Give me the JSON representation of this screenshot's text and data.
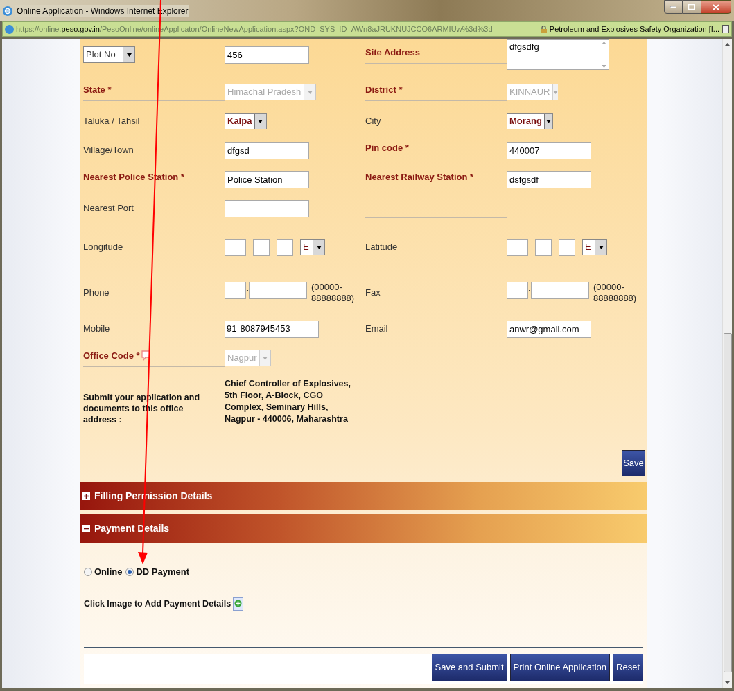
{
  "window": {
    "title": "Online Application - Windows Internet Explorer",
    "url_scheme": "https://online.",
    "url_domain": "peso.gov.in",
    "url_path": "/PesoOnline/onlineApplicaton/OnlineNewApplication.aspx?OND_SYS_ID=AWn8aJRUKNUJCCO6ARMIUw%3d%3d",
    "site_identity": "Petroleum and Explosives Safety Organization [I..."
  },
  "form_rows": [
    {
      "kind": "top",
      "cells": [
        {
          "label": {
            "kind": "select",
            "text": "Plot No"
          },
          "control": {
            "kind": "text",
            "value": "456"
          }
        },
        {
          "label": {
            "kind": "required",
            "text": "Site Address"
          },
          "control": {
            "kind": "textarea",
            "value": "dfgsdfg"
          }
        }
      ]
    },
    {
      "kind": "plain",
      "cells": [
        {
          "label": {
            "kind": "required",
            "text": "State *"
          },
          "control": {
            "kind": "select",
            "value": "Himachal Pradesh",
            "disabled": true
          }
        },
        {
          "label": {
            "kind": "required",
            "text": "District *"
          },
          "control": {
            "kind": "select",
            "value": "KINNAUR",
            "disabled": true
          }
        }
      ]
    },
    {
      "kind": "plain",
      "cells": [
        {
          "label": {
            "kind": "plain",
            "text": "Taluka / Tahsil"
          },
          "control": {
            "kind": "select",
            "value": "Kalpa",
            "disabled": false
          }
        },
        {
          "label": {
            "kind": "plain",
            "text": "City"
          },
          "control": {
            "kind": "select",
            "value": "Morang",
            "disabled": false
          }
        }
      ]
    },
    {
      "kind": "plain",
      "cells": [
        {
          "label": {
            "kind": "plain",
            "text": "Village/Town"
          },
          "control": {
            "kind": "text",
            "value": "dfgsd"
          }
        },
        {
          "label": {
            "kind": "required",
            "text": "Pin code *"
          },
          "control": {
            "kind": "text",
            "value": "440007"
          }
        }
      ]
    },
    {
      "kind": "plain",
      "cells": [
        {
          "label": {
            "kind": "required",
            "text": "Nearest Police Station *"
          },
          "control": {
            "kind": "text",
            "value": "Police Station"
          }
        },
        {
          "label": {
            "kind": "required",
            "text": "Nearest Railway Station *"
          },
          "control": {
            "kind": "text",
            "value": "dsfgsdf"
          }
        }
      ]
    },
    {
      "kind": "plain",
      "cells": [
        {
          "label": {
            "kind": "plain",
            "text": "Nearest Port"
          },
          "control": {
            "kind": "text"
          }
        },
        {
          "label": {
            "kind": "rule"
          },
          "control": {
            "kind": "none"
          }
        }
      ]
    },
    {
      "kind": "tall",
      "cells": [
        {
          "label": {
            "kind": "plain",
            "text": "Longitude"
          },
          "control": {
            "kind": "coord",
            "direction": "E"
          }
        },
        {
          "label": {
            "kind": "plain",
            "text": "Latitude"
          },
          "control": {
            "kind": "coord",
            "direction": "E"
          }
        }
      ]
    },
    {
      "kind": "phone",
      "cells": [
        {
          "label": {
            "kind": "plain",
            "text": "Phone"
          },
          "control": {
            "kind": "phone",
            "hint": "(00000-88888888)"
          }
        },
        {
          "label": {
            "kind": "plain",
            "text": "Fax"
          },
          "control": {
            "kind": "phone",
            "hint": "(00000-88888888)"
          }
        }
      ]
    },
    {
      "kind": "plain",
      "cells": [
        {
          "label": {
            "kind": "plain",
            "text": "Mobile"
          },
          "control": {
            "kind": "mobile",
            "prefix": "91",
            "value": "8087945453"
          }
        },
        {
          "label": {
            "kind": "plain",
            "text": "Email"
          },
          "control": {
            "kind": "text",
            "value": "anwr@gmail.com"
          }
        }
      ]
    },
    {
      "kind": "plain",
      "cells": [
        {
          "label": {
            "kind": "required_help",
            "text": "Office Code *"
          },
          "control": {
            "kind": "select",
            "value": "Nagpur",
            "disabled": true
          }
        }
      ]
    }
  ],
  "office_address": {
    "label": "Submit your application and documents to this office address :",
    "value": "Chief Controller of Explosives, 5th Floor, A-Block, CGO Complex, Seminary Hills, Nagpur - 440006, Maharashtra"
  },
  "save_button": "Save",
  "sections": [
    {
      "title": "Filling Permission Details",
      "expanded": false
    },
    {
      "title": "Payment Details",
      "expanded": true
    }
  ],
  "payment": {
    "options": [
      {
        "label": "Online",
        "selected": false
      },
      {
        "label": "DD Payment",
        "selected": true
      }
    ],
    "instruction": "Click Image to Add Payment Details"
  },
  "footer_buttons": [
    "Save and Submit",
    "Print Online Application",
    "Reset"
  ]
}
